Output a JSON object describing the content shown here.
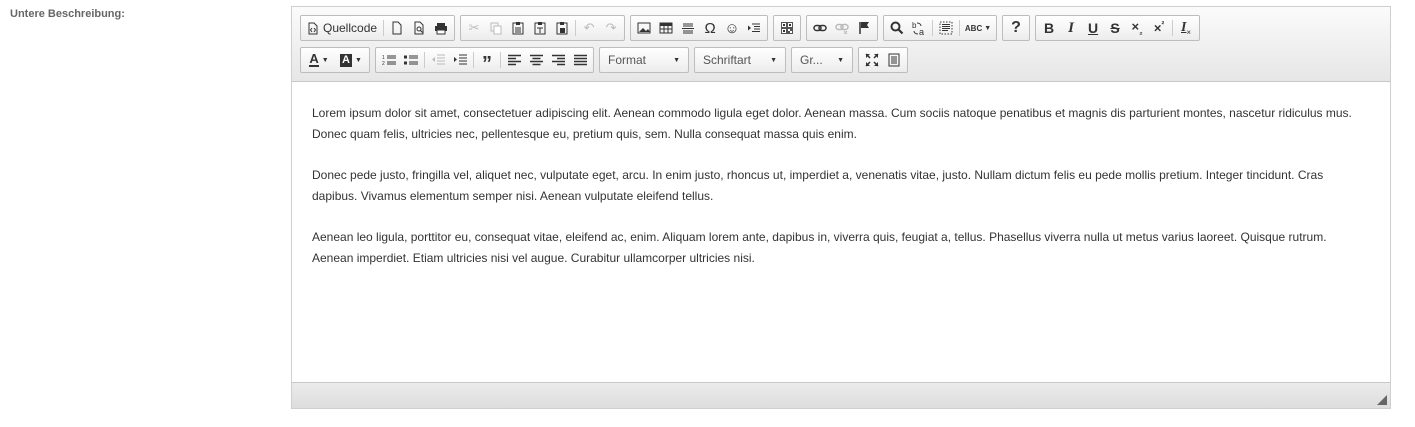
{
  "field_label": "Untere Beschreibung:",
  "toolbar": {
    "source_label": "Quellcode",
    "format_label": "Format",
    "font_label": "Schriftart",
    "size_label": "Gr...",
    "bold_glyph": "B",
    "italic_glyph": "I",
    "underline_glyph": "U",
    "strike_glyph": "S",
    "help_glyph": "?",
    "spell_glyph": "ABC",
    "icons": [
      "source-icon",
      "new-page-icon",
      "preview-icon",
      "print-icon",
      "cut-icon",
      "copy-icon",
      "paste-icon",
      "paste-text-icon",
      "paste-word-icon",
      "undo-icon",
      "redo-icon",
      "image-icon",
      "table-icon",
      "horizontal-line-icon",
      "special-char-icon",
      "smiley-icon",
      "page-break-icon",
      "qr-code-icon",
      "link-icon",
      "unlink-icon",
      "anchor-icon",
      "find-icon",
      "replace-icon",
      "select-all-icon",
      "spellcheck-icon",
      "help-icon",
      "bold-icon",
      "italic-icon",
      "underline-icon",
      "strike-icon",
      "subscript-icon",
      "superscript-icon",
      "remove-format-icon",
      "text-color-icon",
      "bg-color-icon",
      "numbered-list-icon",
      "bulleted-list-icon",
      "outdent-icon",
      "indent-icon",
      "blockquote-icon",
      "align-left-icon",
      "align-center-icon",
      "align-right-icon",
      "justify-icon",
      "maximize-icon",
      "show-blocks-icon"
    ]
  },
  "content": {
    "paragraphs": [
      "Lorem ipsum dolor sit amet, consectetuer adipiscing elit. Aenean commodo ligula eget dolor. Aenean massa. Cum sociis natoque penatibus et magnis dis parturient montes, nascetur ridiculus mus. Donec quam felis, ultricies nec, pellentesque eu, pretium quis, sem. Nulla consequat massa quis enim.",
      "Donec pede justo, fringilla vel, aliquet nec, vulputate eget, arcu. In enim justo, rhoncus ut, imperdiet a, venenatis vitae, justo. Nullam dictum felis eu pede mollis pretium. Integer tincidunt. Cras dapibus. Vivamus elementum semper nisi. Aenean vulputate eleifend tellus.",
      "Aenean leo ligula, porttitor eu, consequat vitae, eleifend ac, enim. Aliquam lorem ante, dapibus in, viverra quis, feugiat a, tellus. Phasellus viverra nulla ut metus varius laoreet. Quisque rutrum. Aenean imperdiet. Etiam ultricies nisi vel augue. Curabitur ullamcorper ultricies nisi."
    ]
  }
}
